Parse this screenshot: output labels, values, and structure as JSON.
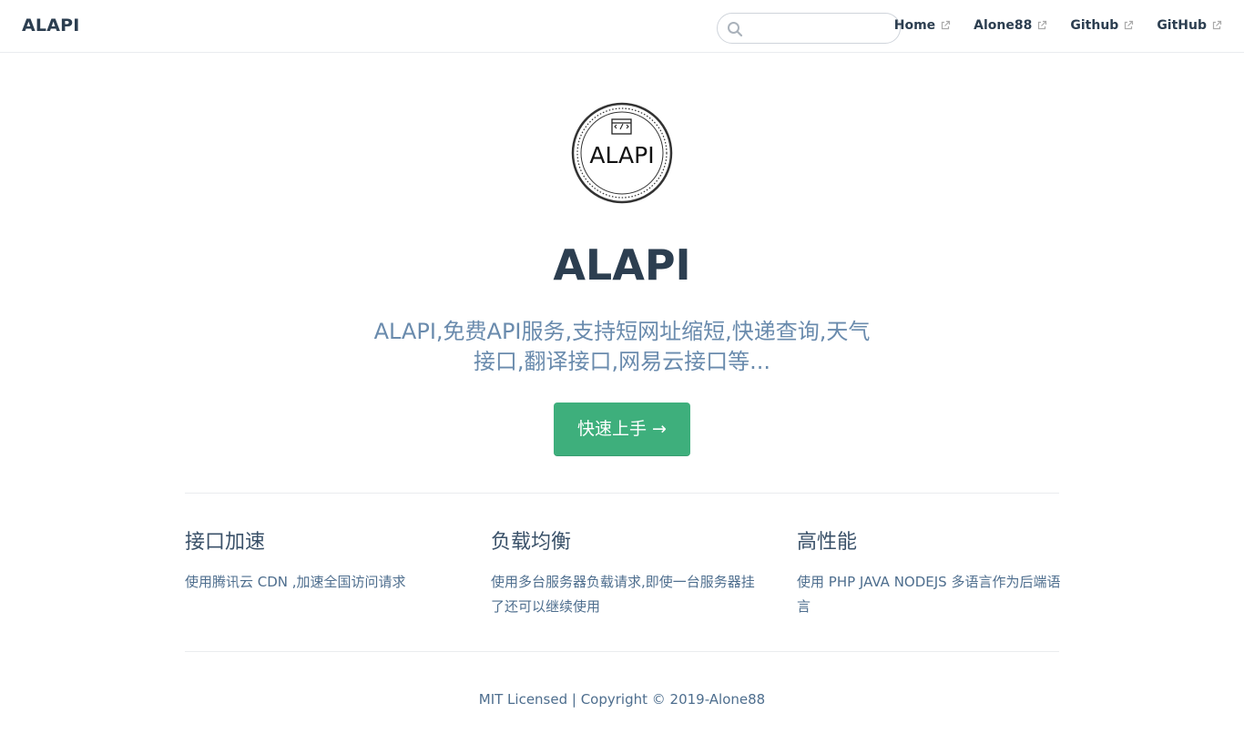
{
  "navbar": {
    "site_name": "ALAPI",
    "search": {
      "value": "",
      "placeholder": "",
      "icon": "search-icon"
    },
    "links": [
      {
        "label": "Home",
        "icon": "external-link-icon"
      },
      {
        "label": "Alone88",
        "icon": "external-link-icon"
      },
      {
        "label": "Github",
        "icon": "external-link-icon"
      },
      {
        "label": "GitHub",
        "icon": "external-link-icon"
      }
    ]
  },
  "hero": {
    "logo_text": "ALAPI",
    "title": "ALAPI",
    "description": "ALAPI,免费API服务,支持短网址缩短,快递查询,天气接口,翻译接口,网易云接口等...",
    "action_label": "快速上手 →"
  },
  "features": [
    {
      "title": "接口加速",
      "details": "使用腾讯云 CDN ,加速全国访问请求"
    },
    {
      "title": "负载均衡",
      "details": "使用多台服务器负载请求,即使一台服务器挂了还可以继续使用"
    },
    {
      "title": "高性能",
      "details": "使用 PHP JAVA NODEJS 多语言作为后端语言"
    }
  ],
  "footer": {
    "text": "MIT Licensed | Copyright © 2019-Alone88"
  },
  "colors": {
    "accent": "#3eaf7c",
    "text": "#2c3e50",
    "description": "#6a8bad",
    "border": "#eaecef"
  }
}
